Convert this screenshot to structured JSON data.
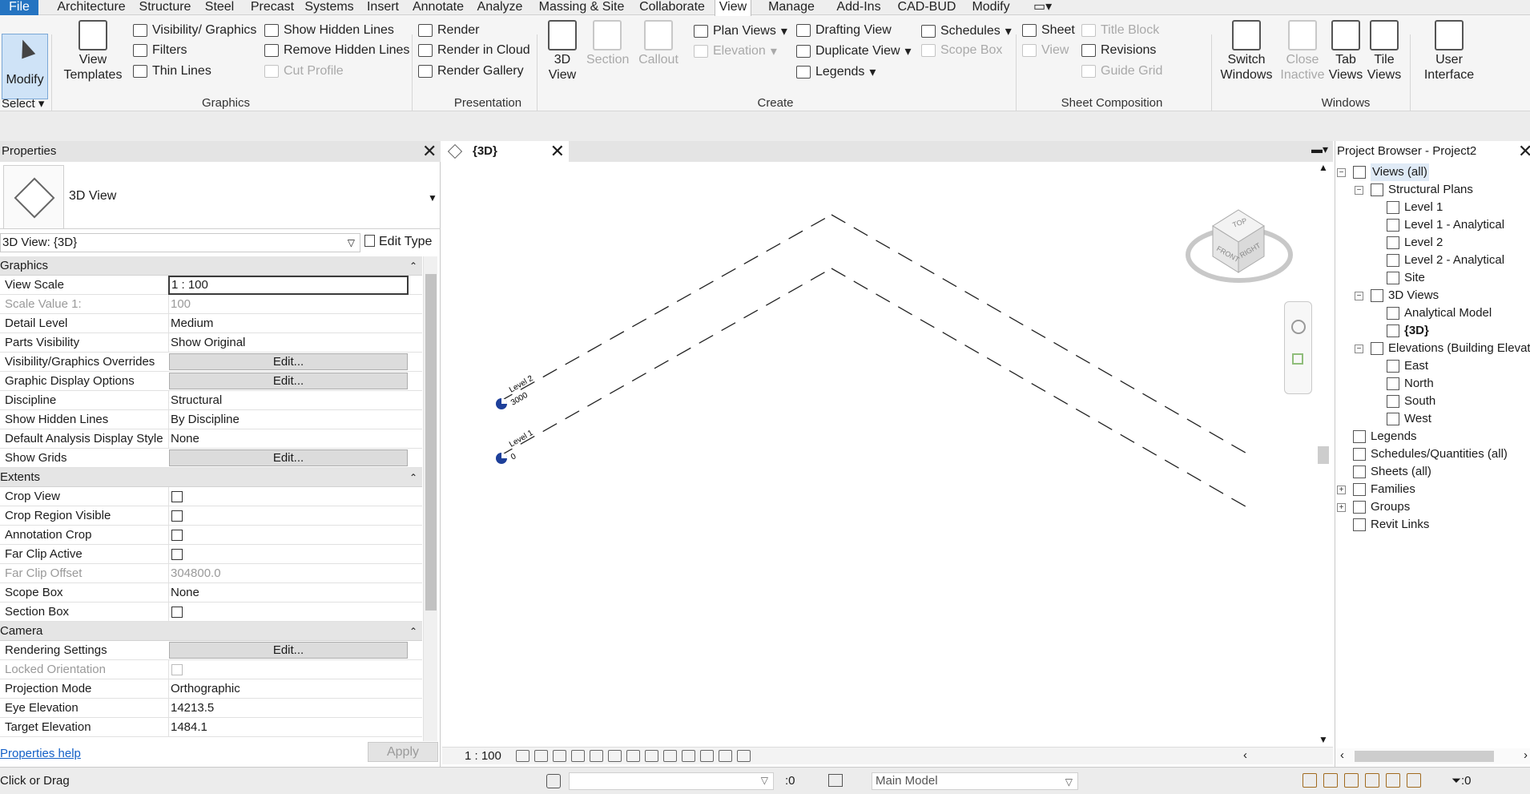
{
  "menu": {
    "tabs": [
      "File",
      "Architecture",
      "Structure",
      "Steel",
      "Precast",
      "Systems",
      "Insert",
      "Annotate",
      "Analyze",
      "Massing & Site",
      "Collaborate",
      "View",
      "Manage",
      "Add-Ins",
      "CAD-BUD",
      "Modify"
    ],
    "active": "View"
  },
  "ribbon": {
    "select": {
      "modify": "Modify",
      "select_label": "Select"
    },
    "graphics": {
      "panel": "Graphics",
      "view_templates": "View Templates",
      "visibility_graphics": "Visibility/ Graphics",
      "filters": "Filters",
      "thin_lines": "Thin Lines",
      "show_hidden_lines": "Show Hidden Lines",
      "remove_hidden_lines": "Remove Hidden Lines",
      "cut_profile": "Cut Profile"
    },
    "presentation": {
      "panel": "Presentation",
      "render": "Render",
      "render_cloud": "Render in Cloud",
      "render_gallery": "Render Gallery"
    },
    "create": {
      "panel": "Create",
      "view_3d": "3D View",
      "section": "Section",
      "callout": "Callout",
      "plan_views": "Plan Views",
      "elevation": "Elevation",
      "drafting_view": "Drafting View",
      "duplicate_view": "Duplicate View",
      "legends": "Legends",
      "schedules": "Schedules",
      "scope_box": "Scope Box"
    },
    "sheet": {
      "panel": "Sheet Composition",
      "sheet": "Sheet",
      "view": "View",
      "title_block": "Title Block",
      "revisions": "Revisions",
      "guide_grid": "Guide Grid"
    },
    "windows": {
      "panel": "Windows",
      "switch_windows": "Switch Windows",
      "close_inactive": "Close Inactive",
      "tab_views": "Tab Views",
      "tile_views": "Tile Views",
      "user_interface": "User Interface"
    }
  },
  "properties": {
    "title": "Properties",
    "type_name": "3D View",
    "view_selector": "3D View: {3D}",
    "edit_type": "Edit Type",
    "groups": [
      {
        "name": "Graphics",
        "rows": [
          {
            "name": "View Scale",
            "value": "1 : 100",
            "kind": "boxed"
          },
          {
            "name": "Scale Value    1:",
            "value": "100",
            "kind": "dim"
          },
          {
            "name": "Detail Level",
            "value": "Medium",
            "kind": "text"
          },
          {
            "name": "Parts Visibility",
            "value": "Show Original",
            "kind": "text"
          },
          {
            "name": "Visibility/Graphics Overrides",
            "value": "Edit...",
            "kind": "button"
          },
          {
            "name": "Graphic Display Options",
            "value": "Edit...",
            "kind": "button"
          },
          {
            "name": "Discipline",
            "value": "Structural",
            "kind": "text"
          },
          {
            "name": "Show Hidden Lines",
            "value": "By Discipline",
            "kind": "text"
          },
          {
            "name": "Default Analysis Display Style",
            "value": "None",
            "kind": "text"
          },
          {
            "name": "Show Grids",
            "value": "Edit...",
            "kind": "button"
          }
        ]
      },
      {
        "name": "Extents",
        "rows": [
          {
            "name": "Crop View",
            "value": "",
            "kind": "check"
          },
          {
            "name": "Crop Region Visible",
            "value": "",
            "kind": "check"
          },
          {
            "name": "Annotation Crop",
            "value": "",
            "kind": "check"
          },
          {
            "name": "Far Clip Active",
            "value": "",
            "kind": "check"
          },
          {
            "name": "Far Clip Offset",
            "value": "304800.0",
            "kind": "dim"
          },
          {
            "name": "Scope Box",
            "value": "None",
            "kind": "text"
          },
          {
            "name": "Section Box",
            "value": "",
            "kind": "check"
          }
        ]
      },
      {
        "name": "Camera",
        "rows": [
          {
            "name": "Rendering Settings",
            "value": "Edit...",
            "kind": "button"
          },
          {
            "name": "Locked Orientation",
            "value": "",
            "kind": "dimcheck"
          },
          {
            "name": "Projection Mode",
            "value": "Orthographic",
            "kind": "text"
          },
          {
            "name": "Eye Elevation",
            "value": "14213.5",
            "kind": "text"
          },
          {
            "name": "Target Elevation",
            "value": "1484.1",
            "kind": "text"
          }
        ]
      }
    ],
    "help": "Properties help",
    "apply": "Apply"
  },
  "view": {
    "tab": "{3D}",
    "scale": "1 : 100",
    "levels": [
      {
        "name": "Level 2",
        "elevation": "3000"
      },
      {
        "name": "Level 1",
        "elevation": "0"
      }
    ],
    "cube_faces": [
      "TOP",
      "FRONT",
      "RIGHT"
    ]
  },
  "browser": {
    "title": "Project Browser - Project2",
    "nodes": [
      {
        "label": "Views (all)",
        "level": 0,
        "toggle": "−",
        "sel": true
      },
      {
        "label": "Structural Plans",
        "level": 1,
        "toggle": "−"
      },
      {
        "label": "Level 1",
        "level": 2
      },
      {
        "label": "Level 1 - Analytical",
        "level": 2
      },
      {
        "label": "Level 2",
        "level": 2
      },
      {
        "label": "Level 2 - Analytical",
        "level": 2
      },
      {
        "label": "Site",
        "level": 2
      },
      {
        "label": "3D Views",
        "level": 1,
        "toggle": "−"
      },
      {
        "label": "Analytical Model",
        "level": 2
      },
      {
        "label": "{3D}",
        "level": 2,
        "bold": true
      },
      {
        "label": "Elevations (Building Elevation)",
        "level": 1,
        "toggle": "−"
      },
      {
        "label": "East",
        "level": 2
      },
      {
        "label": "North",
        "level": 2
      },
      {
        "label": "South",
        "level": 2
      },
      {
        "label": "West",
        "level": 2
      },
      {
        "label": "Legends",
        "level": 0
      },
      {
        "label": "Schedules/Quantities (all)",
        "level": 0
      },
      {
        "label": "Sheets (all)",
        "level": 0
      },
      {
        "label": "Families",
        "level": 0,
        "toggle": "+"
      },
      {
        "label": "Groups",
        "level": 0,
        "toggle": "+"
      },
      {
        "label": "Revit Links",
        "level": 0
      }
    ]
  },
  "status": {
    "text": "Click or Drag",
    "worksets_count": ":0",
    "model": "Main Model",
    "filter_count": ":0"
  },
  "colors": {
    "file_tab": "#2574c1",
    "level_marker": "#1d3f9a",
    "selected_btn": "#cfe3f7"
  }
}
